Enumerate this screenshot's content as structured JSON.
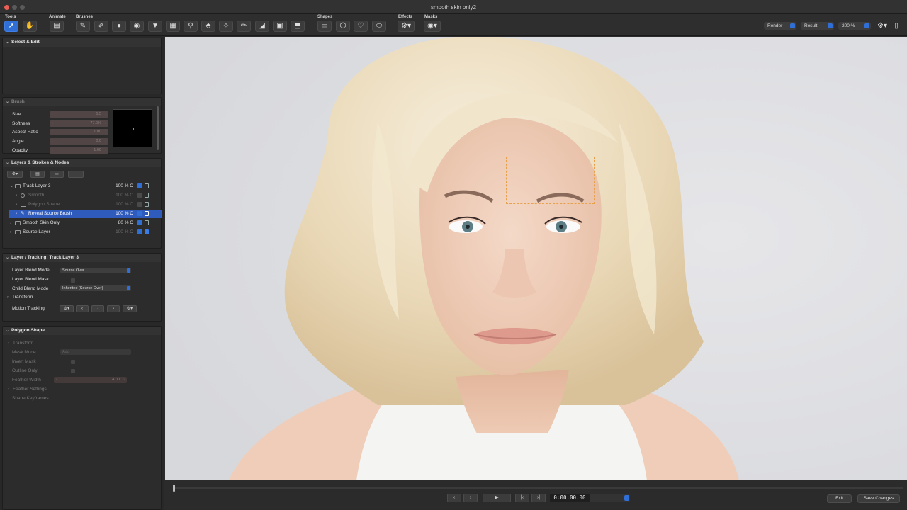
{
  "window": {
    "title": "smooth skin only2"
  },
  "toolbar": {
    "groups": {
      "tools": "Tools",
      "animate": "Animate",
      "brushes": "Brushes",
      "shapes": "Shapes",
      "effects": "Effects",
      "masks": "Masks"
    },
    "render_label": "Render",
    "result_label": "Result",
    "zoom": "200 %"
  },
  "panels": {
    "select_edit": {
      "title": "Select & Edit"
    },
    "brush": {
      "title": "Brush",
      "fields": [
        {
          "label": "Size",
          "value": "5.5"
        },
        {
          "label": "Softness",
          "value": "77.0%"
        },
        {
          "label": "Aspect Ratio",
          "value": "1.00"
        },
        {
          "label": "Angle",
          "value": "0.0"
        },
        {
          "label": "Opacity",
          "value": "1.00"
        }
      ]
    },
    "layers": {
      "title": "Layers & Strokes & Nodes",
      "rows": [
        {
          "name": "Track Layer 3",
          "pct": "100 % C"
        },
        {
          "name": "Smooth",
          "pct": "100 % C"
        },
        {
          "name": "Polygon Shape",
          "pct": "100 % C"
        },
        {
          "name": "Reveal Source Brush",
          "pct": "100 % C"
        },
        {
          "name": "Smooth Skin Only",
          "pct": "80 % C"
        },
        {
          "name": "Source Layer",
          "pct": "100 % C"
        }
      ]
    },
    "layer_tracking": {
      "title": "Layer / Tracking: Track Layer 3",
      "blend_mode_label": "Layer Blend Mode",
      "blend_mode_value": "Source Over",
      "blend_mask_label": "Layer Blend Mask",
      "child_blend_label": "Child Blend Mode",
      "child_blend_value": "Inherited (Source Over)",
      "transform_label": "Transform",
      "motion_tracking_label": "Motion Tracking"
    },
    "polygon_shape": {
      "title": "Polygon Shape",
      "transform_label": "Transform",
      "mask_mode_label": "Mask Mode",
      "mask_mode_value": "Add",
      "invert_mask_label": "Invert Mask",
      "outline_only_label": "Outline Only",
      "feather_width_label": "Feather Width",
      "feather_width_value": "4.00",
      "feather_settings_label": "Feather Settings",
      "shape_keyframes_label": "Shape Keyframes"
    }
  },
  "playback": {
    "timecode": "0:00:00.00",
    "exit_label": "Exit",
    "save_label": "Save Changes"
  },
  "colors": {
    "accent": "#2f6fd6",
    "selection": "#2f5bbd",
    "mask_outline": "#e8a04a"
  }
}
